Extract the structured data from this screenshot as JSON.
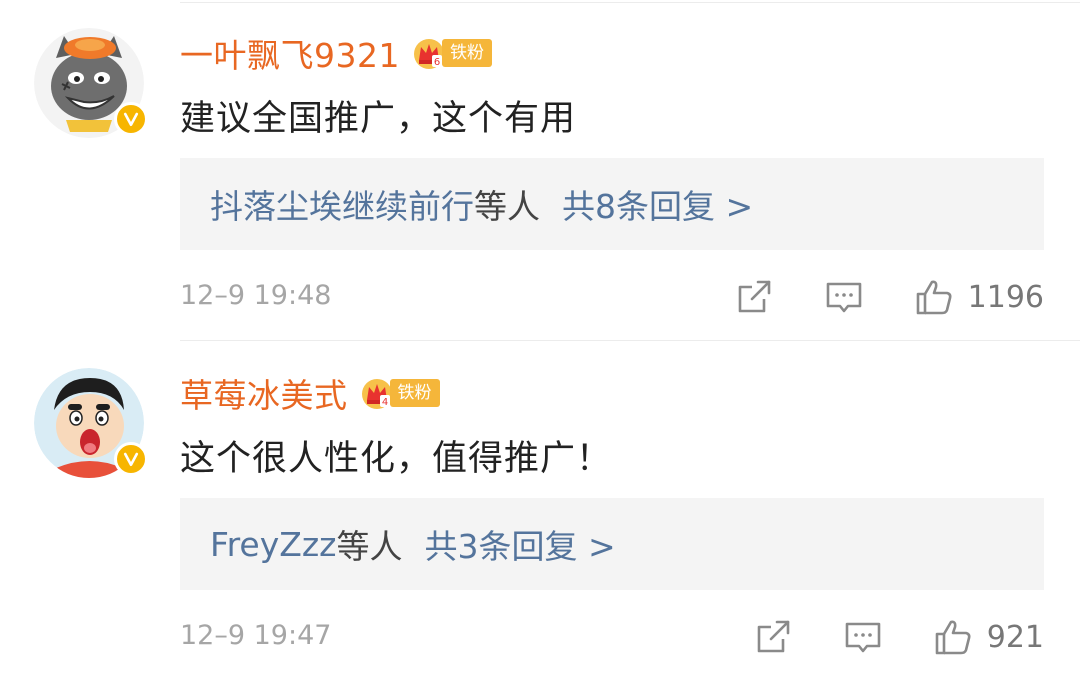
{
  "badge_label": "铁粉",
  "comments": [
    {
      "username": "一叶飘飞9321",
      "text": "建议全国推广，这个有用",
      "reply_users": "抖落尘埃继续前行",
      "reply_etc": "等人",
      "reply_count": "共8条回复 >",
      "timestamp": "12–9 19:48",
      "likes": "1196",
      "badge_level": "6",
      "avatar_icon": "grey-wolf-cartoon-avatar"
    },
    {
      "username": "草莓冰美式",
      "text": "这个很人性化，值得推广！",
      "reply_users": "FreyZzz",
      "reply_etc": "等人",
      "reply_count": "共3条回复 >",
      "timestamp": "12–9 19:47",
      "likes": "921",
      "badge_level": "4",
      "avatar_icon": "crayon-shinchan-cartoon-avatar"
    }
  ],
  "icons": {
    "share": "share-icon",
    "comment": "comment-icon",
    "like": "thumbs-up-icon",
    "verified": "verified-badge-icon",
    "crown": "crown-icon"
  },
  "colors": {
    "username": "#e86722",
    "reply_link": "#54749c",
    "badge": "#f5b63a",
    "verified": "#f7b500",
    "reply_bg": "#f4f4f4"
  }
}
